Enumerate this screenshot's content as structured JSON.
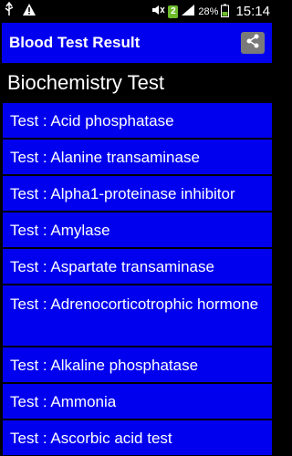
{
  "status_bar": {
    "sim_number": "2",
    "battery_percent": "28%",
    "time": "15:14"
  },
  "app_bar": {
    "title": "Blood Test Result"
  },
  "section": {
    "title": "Biochemistry Test"
  },
  "tests": [
    "Test : Acid phosphatase",
    "Test : Alanine transaminase",
    "Test : Alpha1-proteinase inhibitor",
    "Test : Amylase",
    "Test : Aspartate transaminase",
    "Test : Adrenocorticotrophic hormone",
    "Test : Alkaline phosphatase",
    "Test : Ammonia",
    "Test : Ascorbic acid test"
  ],
  "icons": {
    "usb": "usb-icon",
    "warning": "warning-icon",
    "share": "share-icon"
  }
}
